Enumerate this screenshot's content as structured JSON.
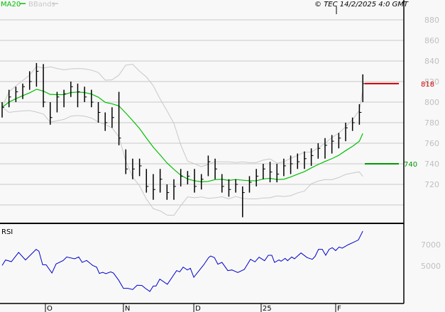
{
  "legend": {
    "ma_label": "MA20",
    "bb_label": "BBands",
    "copyright": "© TEC 14/2/2025 4:0 GMT"
  },
  "colors": {
    "ma": "#00c000",
    "bbands": "#c8c8c8",
    "bars": "#000000",
    "rsi": "#0000cc",
    "resistance": "#cc0000",
    "support": "#009900",
    "grid": "#c8c8c8"
  },
  "chart_data": [
    {
      "type": "ohlc",
      "title": "Price",
      "y_ticks": [
        "880",
        "860",
        "840",
        "820",
        "800",
        "780",
        "760",
        "740",
        "720"
      ],
      "ylim": [
        686,
        880
      ],
      "ma_period_bars": 10,
      "bars": [
        [
          0,
          800,
          785,
          795
        ],
        [
          2,
          812,
          795,
          805
        ],
        [
          4,
          815,
          800,
          810
        ],
        [
          6,
          818,
          803,
          815
        ],
        [
          8,
          830,
          812,
          820
        ],
        [
          10,
          838,
          815,
          830
        ],
        [
          12,
          837,
          795,
          800
        ],
        [
          14,
          800,
          778,
          785
        ],
        [
          16,
          810,
          790,
          805
        ],
        [
          18,
          812,
          795,
          808
        ],
        [
          20,
          820,
          805,
          815
        ],
        [
          22,
          818,
          795,
          810
        ],
        [
          24,
          815,
          800,
          805
        ],
        [
          26,
          812,
          795,
          800
        ],
        [
          28,
          800,
          780,
          790
        ],
        [
          30,
          790,
          772,
          780
        ],
        [
          32,
          795,
          775,
          785
        ],
        [
          34,
          810,
          758,
          765
        ],
        [
          36,
          754,
          730,
          735
        ],
        [
          38,
          745,
          725,
          735
        ],
        [
          40,
          745,
          728,
          738
        ],
        [
          42,
          735,
          712,
          718
        ],
        [
          44,
          730,
          705,
          715
        ],
        [
          46,
          735,
          712,
          725
        ],
        [
          48,
          720,
          705,
          712
        ],
        [
          50,
          725,
          705,
          718
        ],
        [
          52,
          735,
          718,
          728
        ],
        [
          54,
          733,
          720,
          728
        ],
        [
          56,
          735,
          712,
          718
        ],
        [
          58,
          730,
          715,
          725
        ],
        [
          60,
          748,
          728,
          742
        ],
        [
          62,
          745,
          725,
          735
        ],
        [
          64,
          730,
          712,
          718
        ],
        [
          66,
          725,
          708,
          715
        ],
        [
          68,
          725,
          712,
          720
        ],
        [
          70,
          718,
          688,
          712
        ],
        [
          72,
          728,
          712,
          722
        ],
        [
          74,
          735,
          718,
          728
        ],
        [
          76,
          740,
          725,
          735
        ],
        [
          78,
          742,
          722,
          732
        ],
        [
          80,
          740,
          722,
          730
        ],
        [
          82,
          745,
          728,
          738
        ],
        [
          84,
          748,
          730,
          740
        ],
        [
          86,
          750,
          735,
          742
        ],
        [
          88,
          752,
          735,
          745
        ],
        [
          90,
          755,
          738,
          748
        ],
        [
          92,
          760,
          745,
          755
        ],
        [
          94,
          765,
          745,
          758
        ],
        [
          96,
          768,
          750,
          762
        ],
        [
          98,
          770,
          755,
          765
        ],
        [
          100,
          780,
          762,
          775
        ],
        [
          102,
          785,
          772,
          780
        ],
        [
          104,
          798,
          778,
          790
        ],
        [
          105,
          827,
          800,
          818
        ]
      ],
      "levels": [
        {
          "name": "resistance",
          "value": 818,
          "label": "818"
        },
        {
          "name": "support",
          "value": 740,
          "label": "740"
        }
      ]
    },
    {
      "type": "line",
      "title": "RSI",
      "y_ticks": [
        "7000",
        "5000"
      ],
      "y_tick_values": [
        70,
        50
      ],
      "x_labels": [
        {
          "t": 12.6,
          "label": "O"
        },
        {
          "t": 35.3,
          "label": "N"
        },
        {
          "t": 55.8,
          "label": "D"
        },
        {
          "t": 75.4,
          "label": "25"
        },
        {
          "t": 97.1,
          "label": "F"
        }
      ],
      "points": [
        [
          0,
          50.4
        ],
        [
          1,
          55.6
        ],
        [
          2.7,
          54
        ],
        [
          4.8,
          62.7
        ],
        [
          6.8,
          55.6
        ],
        [
          9.9,
          65.6
        ],
        [
          10.7,
          63.8
        ],
        [
          11.8,
          51.1
        ],
        [
          12.8,
          51.1
        ],
        [
          14.5,
          43.3
        ],
        [
          15.7,
          51.8
        ],
        [
          17.8,
          55.1
        ],
        [
          18.8,
          58.4
        ],
        [
          21.1,
          56.7
        ],
        [
          22.3,
          58.4
        ],
        [
          23.3,
          53.3
        ],
        [
          24.6,
          55.1
        ],
        [
          26.4,
          50.4
        ],
        [
          27.5,
          48.9
        ],
        [
          28.3,
          42.9
        ],
        [
          29.3,
          44
        ],
        [
          30.2,
          42.7
        ],
        [
          31.6,
          44.4
        ],
        [
          32.4,
          43.3
        ],
        [
          33.9,
          36.7
        ],
        [
          35.3,
          28.9
        ],
        [
          36.6,
          28.9
        ],
        [
          38,
          27.8
        ],
        [
          39.3,
          31.8
        ],
        [
          40.7,
          31.6
        ],
        [
          41.7,
          28.9
        ],
        [
          43,
          26
        ],
        [
          44,
          31.1
        ],
        [
          44.8,
          31.1
        ],
        [
          45.9,
          37.6
        ],
        [
          48.1,
          32.7
        ],
        [
          50.8,
          45.6
        ],
        [
          51.7,
          44.4
        ],
        [
          52.7,
          48.9
        ],
        [
          53.9,
          46.2
        ],
        [
          54.8,
          47.8
        ],
        [
          55.8,
          39.3
        ],
        [
          58.7,
          51.1
        ],
        [
          60.1,
          57.8
        ],
        [
          60.7,
          59.3
        ],
        [
          61.8,
          57.8
        ],
        [
          62.8,
          51.6
        ],
        [
          64,
          53.3
        ],
        [
          65.7,
          45.6
        ],
        [
          66.9,
          46.2
        ],
        [
          68.6,
          43.8
        ],
        [
          70.5,
          46.7
        ],
        [
          72.3,
          56.2
        ],
        [
          73.6,
          53.8
        ],
        [
          74.8,
          58.2
        ],
        [
          76.4,
          54.9
        ],
        [
          77.5,
          60
        ],
        [
          78.5,
          60
        ],
        [
          79.3,
          53.3
        ],
        [
          80.6,
          55.6
        ],
        [
          81.2,
          54.4
        ],
        [
          82.4,
          57.1
        ],
        [
          83.1,
          54.9
        ],
        [
          84.3,
          58.4
        ],
        [
          85.1,
          56.7
        ],
        [
          87,
          62.2
        ],
        [
          88.8,
          57.8
        ],
        [
          90.3,
          56.2
        ],
        [
          91.1,
          58.9
        ],
        [
          92.1,
          65.6
        ],
        [
          93.2,
          65.6
        ],
        [
          94.2,
          60
        ],
        [
          95.2,
          65.6
        ],
        [
          96.1,
          67.1
        ],
        [
          97.1,
          64.4
        ],
        [
          98.1,
          67.8
        ],
        [
          99,
          66.7
        ],
        [
          100.8,
          70
        ],
        [
          102.3,
          72.2
        ],
        [
          103.7,
          74.4
        ],
        [
          105,
          82.7
        ]
      ]
    }
  ]
}
